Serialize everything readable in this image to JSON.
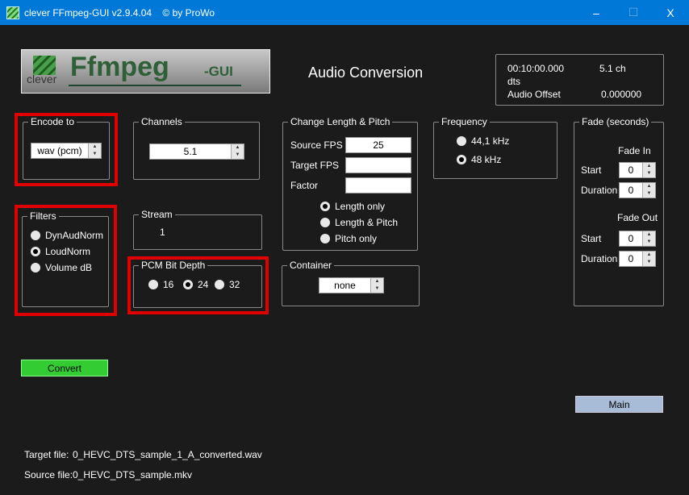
{
  "window": {
    "title": "clever FFmpeg-GUI v2.9.4.04    © by ProWo",
    "min": "–",
    "max": "☐",
    "close": "X"
  },
  "logo": {
    "text": "Ffmpeg",
    "suffix": "-GUI",
    "small": "clever"
  },
  "page_title": "Audio Conversion",
  "info": {
    "duration": "00:10:00.000",
    "channels": "5.1 ch",
    "codec": "dts",
    "offset_label": "Audio Offset",
    "offset_value": "0.000000"
  },
  "encode": {
    "label": "Encode to",
    "value": "wav (pcm)"
  },
  "channels": {
    "label": "Channels",
    "value": "5.1"
  },
  "filters": {
    "label": "Filters",
    "options": [
      {
        "label": "DynAudNorm",
        "checked": false
      },
      {
        "label": "LoudNorm",
        "checked": true
      },
      {
        "label": "Volume dB",
        "checked": false
      }
    ]
  },
  "stream": {
    "label": "Stream",
    "value": "1"
  },
  "pcm": {
    "label": "PCM Bit Depth",
    "options": [
      {
        "label": "16",
        "checked": false
      },
      {
        "label": "24",
        "checked": true
      },
      {
        "label": "32",
        "checked": false
      }
    ]
  },
  "change": {
    "label": "Change Length & Pitch",
    "source_fps_label": "Source FPS",
    "source_fps": "25",
    "target_fps_label": "Target FPS",
    "target_fps": "",
    "factor_label": "Factor",
    "factor": "",
    "options": [
      {
        "label": "Length only",
        "checked": true
      },
      {
        "label": "Length & Pitch",
        "checked": false
      },
      {
        "label": "Pitch only",
        "checked": false
      }
    ]
  },
  "container": {
    "label": "Container",
    "value": "none"
  },
  "frequency": {
    "label": "Frequency",
    "options": [
      {
        "label": "44,1 kHz",
        "checked": false
      },
      {
        "label": "48 kHz",
        "checked": true
      }
    ]
  },
  "fade": {
    "label": "Fade (seconds)",
    "in_label": "Fade In",
    "out_label": "Fade Out",
    "start_label": "Start",
    "duration_label": "Duration",
    "in_start": "0",
    "in_duration": "0",
    "out_start": "0",
    "out_duration": "0"
  },
  "convert_label": "Convert",
  "main_label": "Main",
  "files": {
    "target_label": "Target file:",
    "target": "0_HEVC_DTS_sample_1_A_converted.wav",
    "source_label": "Source file:",
    "source": "0_HEVC_DTS_sample.mkv"
  }
}
